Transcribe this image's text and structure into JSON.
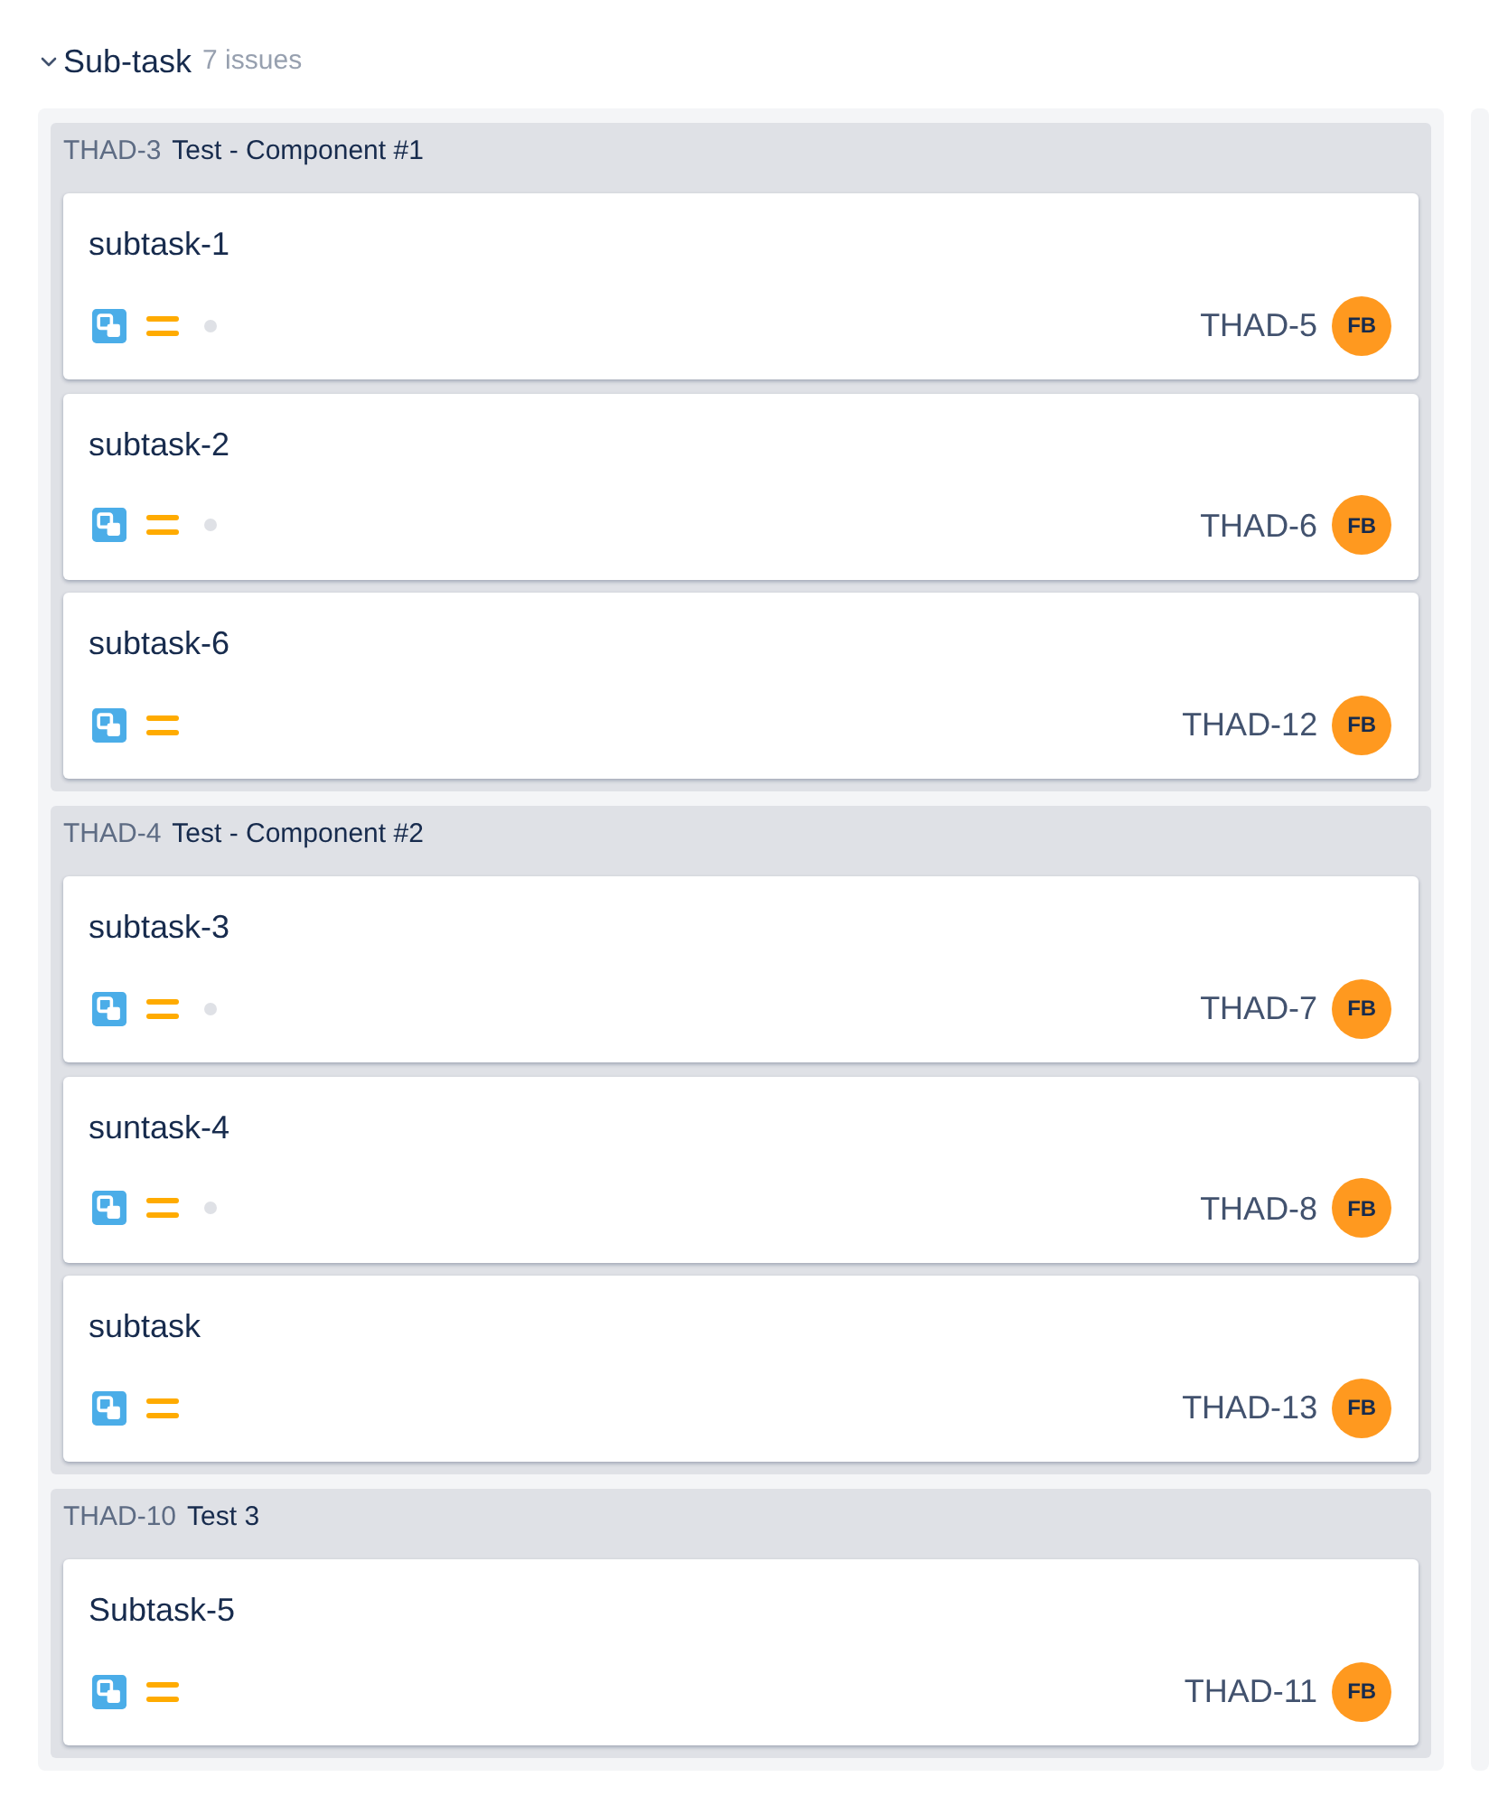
{
  "swimlane": {
    "title": "Sub-task",
    "count": "7 issues",
    "expanded": true
  },
  "groups": [
    {
      "key": "THAD-3",
      "summary": "Test - Component #1",
      "issues": [
        {
          "summary": "subtask-1",
          "key": "THAD-5",
          "assignee": "FB",
          "dot": true
        },
        {
          "summary": "subtask-2",
          "key": "THAD-6",
          "assignee": "FB",
          "dot": true
        },
        {
          "summary": "subtask-6",
          "key": "THAD-12",
          "assignee": "FB",
          "dot": false
        }
      ]
    },
    {
      "key": "THAD-4",
      "summary": "Test - Component #2",
      "issues": [
        {
          "summary": "subtask-3",
          "key": "THAD-7",
          "assignee": "FB",
          "dot": true
        },
        {
          "summary": "suntask-4",
          "key": "THAD-8",
          "assignee": "FB",
          "dot": true
        },
        {
          "summary": "subtask",
          "key": "THAD-13",
          "assignee": "FB",
          "dot": false
        }
      ]
    },
    {
      "key": "THAD-10",
      "summary": "Test 3",
      "issues": [
        {
          "summary": "Subtask-5",
          "key": "THAD-11",
          "assignee": "FB",
          "dot": false
        }
      ]
    }
  ]
}
